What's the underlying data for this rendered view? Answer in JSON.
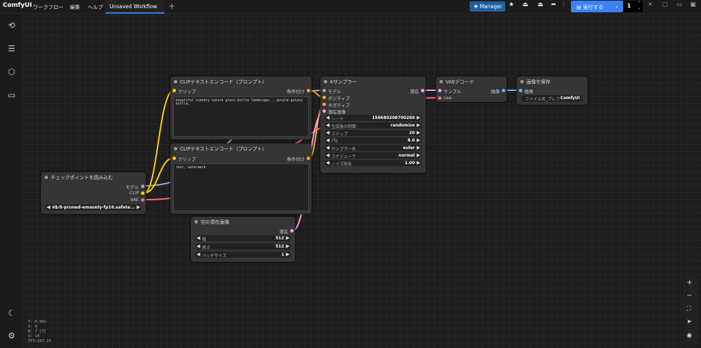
{
  "app": {
    "brand": "ComfyUI"
  },
  "menu": {
    "workflow": "ワークフロー",
    "edit": "編集",
    "help": "ヘルプ"
  },
  "tab": {
    "label": "Unsaved Workflow",
    "new_tab": "+"
  },
  "toolbar": {
    "manager_label": "Manager",
    "run_label": "実行する",
    "run_count": "1"
  },
  "stats": {
    "t": "T: 0.00s",
    "i": "I: 0",
    "n": "N: 7 [7]",
    "v": "V: 14",
    "fps": "FPS:283.19"
  },
  "nodes": {
    "checkpoint": {
      "title": "チェックポイントを読み込む",
      "out_model": "モデル",
      "out_clip": "CLIP",
      "out_vae": "VAE",
      "ckpt_label": "ckpt",
      "ckpt_value": "v1-5-pruned-emaonly-fp16.safete..."
    },
    "clip_pos": {
      "title": "CLIPテキストエンコード（プロンプト）",
      "in_clip": "クリップ",
      "out_cond": "条件付け",
      "text": "beautiful scenery nature glass bottle landscape, , purple galaxy bottle,"
    },
    "clip_neg": {
      "title": "CLIPテキストエンコード（プロンプト）",
      "in_clip": "クリップ",
      "out_cond": "条件付け",
      "text": "text, watermark"
    },
    "ksampler": {
      "title": "Kサンプラー",
      "in_model": "モデル",
      "in_pos": "ポジティブ",
      "in_neg": "ネガティブ",
      "in_latent": "潜在画像",
      "out_latent": "潜在",
      "widgets": [
        {
          "label": "シード",
          "value": "156680208700286"
        },
        {
          "label": "生成後の制御",
          "value": "randomize"
        },
        {
          "label": "ステップ",
          "value": "20"
        },
        {
          "label": "cfg",
          "value": "8.0"
        },
        {
          "label": "サンプラー名",
          "value": "euler"
        },
        {
          "label": "スケジューラ",
          "value": "normal"
        },
        {
          "label": "ノイズ除去",
          "value": "1.00"
        }
      ]
    },
    "vae_decode": {
      "title": "VAEデコード",
      "in_samples": "サンプル",
      "in_vae": "vae",
      "out_image": "画像"
    },
    "save_image": {
      "title": "画像を保存",
      "in_images": "画像",
      "prefix_label": "ファイル名_プレフ",
      "prefix_value": "ComfyUI"
    },
    "empty_latent": {
      "title": "空の潜在画像",
      "out_latent": "潜在",
      "widgets": [
        {
          "label": "幅",
          "value": "512"
        },
        {
          "label": "高さ",
          "value": "512"
        },
        {
          "label": "バッチサイズ",
          "value": "1"
        }
      ]
    }
  },
  "colors": {
    "accent": "#3b82f6",
    "model": "#b39ddb",
    "clip": "#ffd500",
    "vae": "#ff6e6e",
    "conditioning": "#ffa931",
    "latent": "#ff9cf9",
    "image": "#64b5f6"
  }
}
